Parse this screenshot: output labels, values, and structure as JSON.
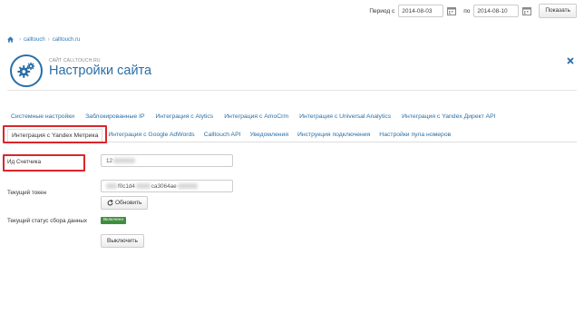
{
  "period": {
    "label_from": "Период с",
    "date_from": "2014-08-03",
    "label_to": "по",
    "date_to": "2014-08-10",
    "show_label": "Показать"
  },
  "breadcrumb": {
    "items": [
      "calltouch",
      "calltouch.ru"
    ]
  },
  "header": {
    "site_label": "САЙТ CALLTOUCH.RU",
    "title": "Настройки сайта",
    "brand_color": "#2a6ea6"
  },
  "tabs": {
    "row1": [
      "Системные настройки",
      "Заблокированные IP",
      "Интеграция с Alytics",
      "Интеграция с AmoCrm",
      "Интеграция с Universal Analytics",
      "Интеграция с Yandex Директ API"
    ],
    "row2": [
      "Интеграция с Yandex Метрика",
      "Интеграция с Google AdWords",
      "Calltouch API",
      "Уведомления",
      "Инструкция подключения",
      "Настройки пула номеров"
    ],
    "active": "Интеграция с Yandex Метрика"
  },
  "form": {
    "counter_label": "Ид Счетчика",
    "counter_value_visible": "12",
    "token_label": "Текущий токен",
    "token_value_visible_1": "f0c1d4",
    "token_value_visible_2": "ca3064ae",
    "refresh_label": "Обновить",
    "status_label": "Текущий статус сбора данных",
    "status_badge": "Включено",
    "disable_label": "Выключить"
  },
  "colors": {
    "highlight": "#d9262b",
    "badge_green": "#3f8e3f",
    "link": "#2a6ea6"
  },
  "icons": [
    "calendar-icon",
    "home-icon",
    "gears-icon",
    "close-icon",
    "refresh-icon"
  ]
}
